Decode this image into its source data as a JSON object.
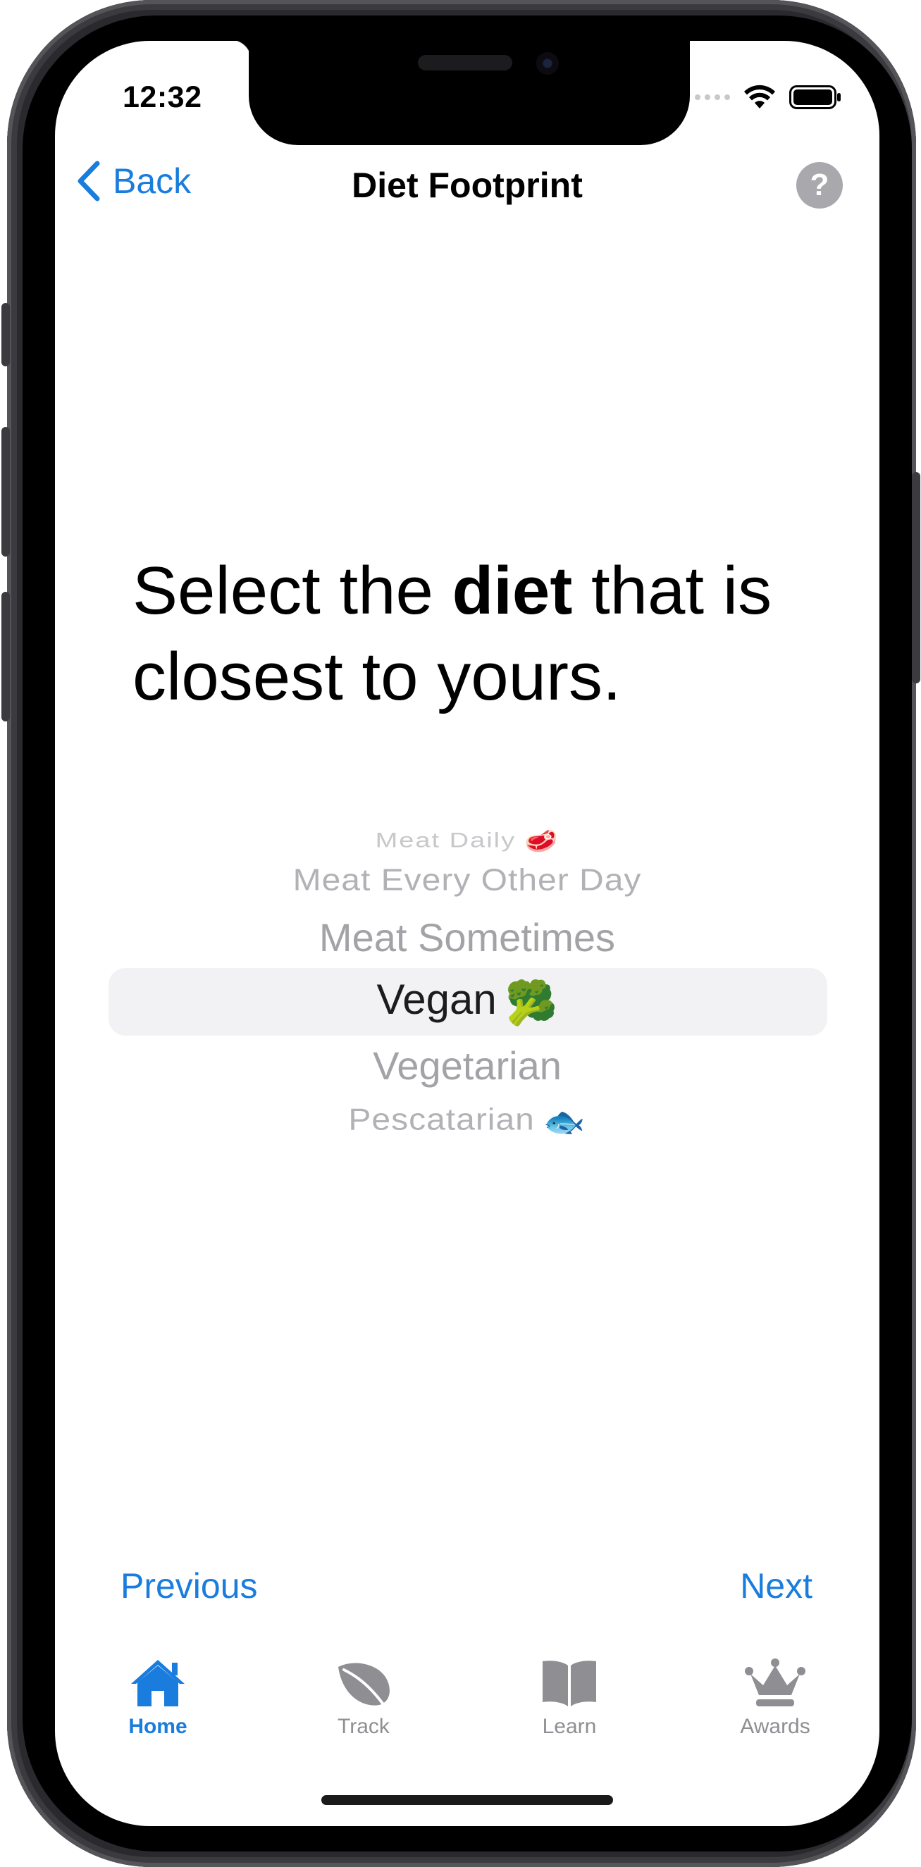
{
  "status_bar": {
    "time": "12:32"
  },
  "nav": {
    "back_label": "Back",
    "title": "Diet Footprint",
    "help_label": "?"
  },
  "heading": {
    "part1": "Select the ",
    "bold": "diet",
    "part2": " that is closest to yours."
  },
  "picker": {
    "options": [
      {
        "label": "Meat Daily",
        "emoji": "🥩"
      },
      {
        "label": "Meat Every Other Day",
        "emoji": ""
      },
      {
        "label": "Meat Sometimes",
        "emoji": ""
      },
      {
        "label": "Vegan",
        "emoji": "🥦"
      },
      {
        "label": "Vegetarian",
        "emoji": ""
      },
      {
        "label": "Pescatarian",
        "emoji": "🐟"
      }
    ],
    "selected": "Vegan"
  },
  "actions": {
    "previous": "Previous",
    "next": "Next"
  },
  "tab_bar": {
    "items": [
      {
        "label": "Home",
        "icon": "house-icon",
        "active": true
      },
      {
        "label": "Track",
        "icon": "leaf-icon",
        "active": false
      },
      {
        "label": "Learn",
        "icon": "book-icon",
        "active": false
      },
      {
        "label": "Awards",
        "icon": "crown-icon",
        "active": false
      }
    ]
  },
  "colors": {
    "accent": "#1a7ddd",
    "inactive": "#8e8e93",
    "help_bg": "#a9a9ad"
  }
}
